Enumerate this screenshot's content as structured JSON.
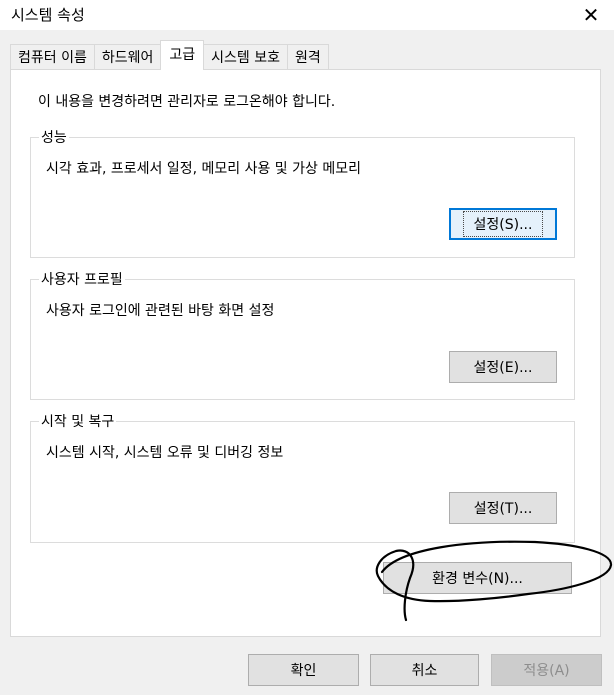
{
  "window": {
    "title": "시스템 속성",
    "close_glyph": "✕"
  },
  "tabs": [
    {
      "label": "컴퓨터 이름"
    },
    {
      "label": "하드웨어"
    },
    {
      "label": "고급"
    },
    {
      "label": "시스템 보호"
    },
    {
      "label": "원격"
    }
  ],
  "panel": {
    "admin_note": "이 내용을 변경하려면 관리자로 로그온해야 합니다.",
    "performance": {
      "title": "성능",
      "description": "시각 효과, 프로세서 일정, 메모리 사용 및 가상 메모리",
      "button": "설정(S)..."
    },
    "user_profiles": {
      "title": "사용자 프로필",
      "description": "사용자 로그인에 관련된 바탕 화면 설정",
      "button": "설정(E)..."
    },
    "startup_recovery": {
      "title": "시작 및 복구",
      "description": "시스템 시작, 시스템 오류 및 디버깅 정보",
      "button": "설정(T)..."
    },
    "env_vars_button": "환경 변수(N)..."
  },
  "footer": {
    "ok": "확인",
    "cancel": "취소",
    "apply": "적용(A)"
  },
  "colors": {
    "accent": "#0078d7",
    "annotation": "#000000"
  }
}
